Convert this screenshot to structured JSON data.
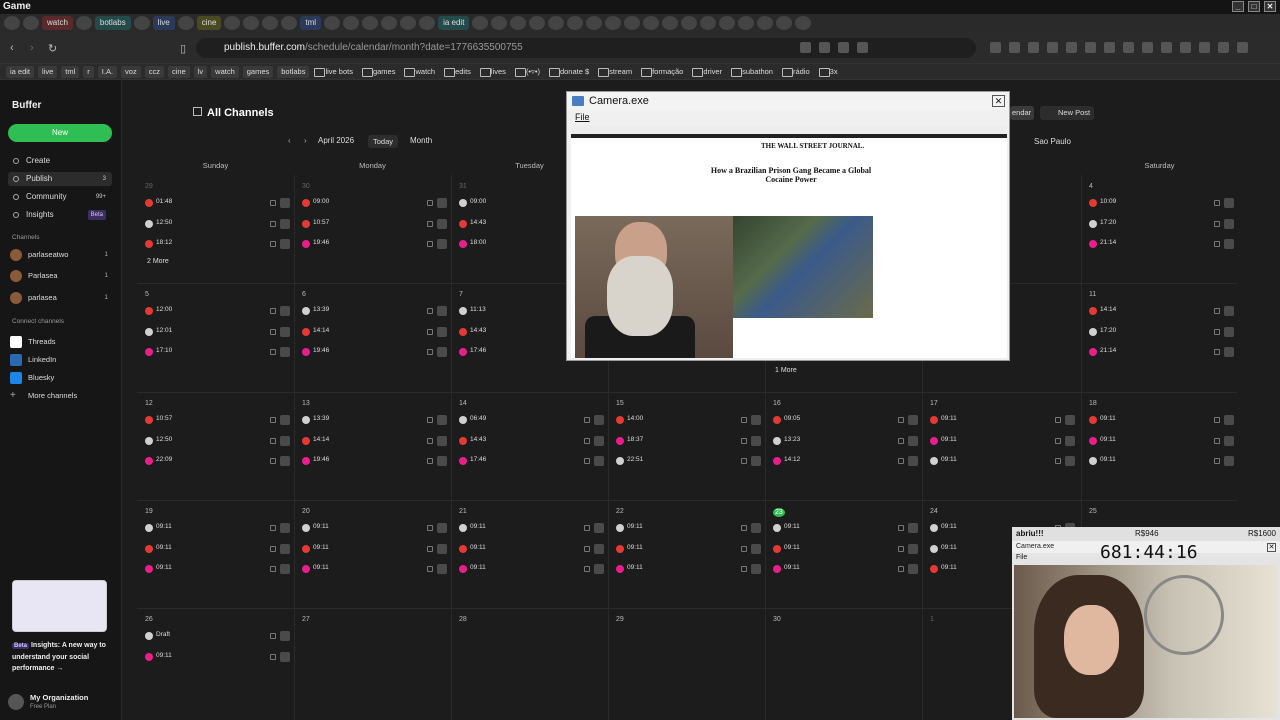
{
  "window": {
    "title": "Game"
  },
  "tabs": [
    "watch",
    "botlabs",
    "live",
    "cine",
    "tml",
    "ia edit"
  ],
  "url": {
    "host": "publish.buffer.com",
    "path": "/schedule/calendar/month?date=1776635500755"
  },
  "bookmarks": [
    "ia edit",
    "live",
    "tml",
    "r",
    "I.A.",
    "voz",
    "ccz",
    "cine",
    "lv",
    "watch",
    "games",
    "botlabs",
    "live bots",
    "games",
    "watch",
    "edits",
    "lives",
    "(•▿•)",
    "donate $",
    "stream",
    "formação",
    "driver",
    "subathon",
    "rádio",
    "3x"
  ],
  "sidebar": {
    "logo": "Buffer",
    "new_label": "New",
    "nav": [
      {
        "label": "Create"
      },
      {
        "label": "Publish",
        "count": "3"
      },
      {
        "label": "Community",
        "count": "99+"
      },
      {
        "label": "Insights",
        "badge": "Beta"
      }
    ],
    "channels_header": "Channels",
    "channels": [
      {
        "name": "parlaseatwo",
        "count": "1"
      },
      {
        "name": "Parlasea",
        "count": "1"
      },
      {
        "name": "parlasea",
        "count": "1"
      }
    ],
    "connect_header": "Connect channels",
    "connect": [
      "Threads",
      "LinkedIn",
      "Bluesky",
      "More channels"
    ],
    "promo": {
      "badge": "Beta",
      "text": "Insights: A new way to understand your social performance →"
    },
    "org": {
      "name": "My Organization",
      "plan": "Free Plan"
    }
  },
  "header": {
    "title": "All Channels",
    "month": "April 2026",
    "today": "Today",
    "view": "Month",
    "calendar_label": "endar",
    "new_post": "New Post",
    "timezone": "Sao Paulo"
  },
  "days": [
    "Sunday",
    "Monday",
    "Tuesday",
    "Saturday"
  ],
  "weeks": [
    {
      "nums": [
        "29",
        "30",
        "31",
        "",
        "",
        "",
        "4"
      ],
      "events": [
        {
          "d": 0,
          "t": "01:48",
          "k": "yt"
        },
        {
          "d": 0,
          "t": "12:50",
          "k": "gr"
        },
        {
          "d": 0,
          "t": "18:12",
          "k": "yt"
        },
        {
          "d": 1,
          "t": "09:00",
          "k": "yt"
        },
        {
          "d": 1,
          "t": "10:57",
          "k": "yt"
        },
        {
          "d": 1,
          "t": "19:46",
          "k": "tt"
        },
        {
          "d": 2,
          "t": "09:00",
          "k": "gr"
        },
        {
          "d": 2,
          "t": "14:43",
          "k": "yt"
        },
        {
          "d": 2,
          "t": "18:00",
          "k": "tt"
        },
        {
          "d": 6,
          "t": "10:09",
          "k": "yt"
        },
        {
          "d": 6,
          "t": "17:20",
          "k": "gr"
        },
        {
          "d": 6,
          "t": "21:14",
          "k": "tt"
        }
      ],
      "more": "2 More"
    },
    {
      "nums": [
        "5",
        "6",
        "7",
        "",
        "",
        "",
        "11"
      ],
      "events": [
        {
          "d": 0,
          "t": "12:00",
          "k": "yt"
        },
        {
          "d": 0,
          "t": "12:01",
          "k": "gr"
        },
        {
          "d": 0,
          "t": "17:10",
          "k": "tt"
        },
        {
          "d": 1,
          "t": "13:39",
          "k": "gr"
        },
        {
          "d": 1,
          "t": "14:14",
          "k": "yt"
        },
        {
          "d": 1,
          "t": "19:46",
          "k": "tt"
        },
        {
          "d": 2,
          "t": "11:13",
          "k": "gr"
        },
        {
          "d": 2,
          "t": "14:43",
          "k": "yt"
        },
        {
          "d": 2,
          "t": "17:46",
          "k": "tt"
        },
        {
          "d": 6,
          "t": "14:14",
          "k": "yt"
        },
        {
          "d": 6,
          "t": "17:20",
          "k": "gr"
        },
        {
          "d": 6,
          "t": "21:14",
          "k": "tt"
        }
      ],
      "more": "1 More"
    },
    {
      "nums": [
        "12",
        "13",
        "14",
        "15",
        "16",
        "17",
        "18"
      ],
      "events": [
        {
          "d": 0,
          "t": "10:57",
          "k": "yt"
        },
        {
          "d": 0,
          "t": "12:50",
          "k": "gr"
        },
        {
          "d": 0,
          "t": "22:09",
          "k": "tt"
        },
        {
          "d": 1,
          "t": "13:39",
          "k": "gr"
        },
        {
          "d": 1,
          "t": "14:14",
          "k": "yt"
        },
        {
          "d": 1,
          "t": "19:46",
          "k": "tt"
        },
        {
          "d": 2,
          "t": "06:49",
          "k": "gr"
        },
        {
          "d": 2,
          "t": "14:43",
          "k": "yt"
        },
        {
          "d": 2,
          "t": "17:46",
          "k": "tt"
        },
        {
          "d": 3,
          "t": "14:00",
          "k": "yt"
        },
        {
          "d": 3,
          "t": "18:37",
          "k": "tt"
        },
        {
          "d": 3,
          "t": "22:51",
          "k": "gr"
        },
        {
          "d": 4,
          "t": "09:05",
          "k": "yt"
        },
        {
          "d": 4,
          "t": "13:23",
          "k": "gr"
        },
        {
          "d": 4,
          "t": "14:12",
          "k": "tt"
        },
        {
          "d": 5,
          "t": "09:11",
          "k": "yt"
        },
        {
          "d": 5,
          "t": "09:11",
          "k": "tt"
        },
        {
          "d": 5,
          "t": "09:11",
          "k": "gr"
        },
        {
          "d": 6,
          "t": "09:11",
          "k": "yt"
        },
        {
          "d": 6,
          "t": "09:11",
          "k": "tt"
        },
        {
          "d": 6,
          "t": "09:11",
          "k": "gr"
        }
      ]
    },
    {
      "nums": [
        "19",
        "20",
        "21",
        "22",
        "23",
        "24",
        "25"
      ],
      "events": [
        {
          "d": 0,
          "t": "09:11",
          "k": "gr"
        },
        {
          "d": 0,
          "t": "09:11",
          "k": "yt"
        },
        {
          "d": 0,
          "t": "09:11",
          "k": "tt"
        },
        {
          "d": 1,
          "t": "09:11",
          "k": "gr"
        },
        {
          "d": 1,
          "t": "09:11",
          "k": "yt"
        },
        {
          "d": 1,
          "t": "09:11",
          "k": "tt"
        },
        {
          "d": 2,
          "t": "09:11",
          "k": "gr"
        },
        {
          "d": 2,
          "t": "09:11",
          "k": "yt"
        },
        {
          "d": 2,
          "t": "09:11",
          "k": "tt"
        },
        {
          "d": 3,
          "t": "09:11",
          "k": "gr"
        },
        {
          "d": 3,
          "t": "09:11",
          "k": "yt"
        },
        {
          "d": 3,
          "t": "09:11",
          "k": "tt"
        },
        {
          "d": 4,
          "t": "09:11",
          "k": "gr"
        },
        {
          "d": 4,
          "t": "09:11",
          "k": "yt"
        },
        {
          "d": 4,
          "t": "09:11",
          "k": "tt"
        },
        {
          "d": 5,
          "t": "09:11",
          "k": "gr"
        },
        {
          "d": 5,
          "t": "09:11",
          "k": "gr"
        },
        {
          "d": 5,
          "t": "09:11",
          "k": "yt"
        }
      ]
    },
    {
      "nums": [
        "26",
        "27",
        "28",
        "29",
        "30",
        "1",
        ""
      ],
      "events": [
        {
          "d": 0,
          "t": "Draft",
          "k": "gr"
        },
        {
          "d": 0,
          "t": "09:11",
          "k": "tt"
        }
      ]
    }
  ],
  "camera": {
    "title": "Camera.exe",
    "menu": "File",
    "site": "THE WALL STREET JOURNAL.",
    "headline": "How a Brazilian Prison Gang Became a Global Cocaine Power"
  },
  "camera2": {
    "goal": "abriu!!!",
    "m1": "R$946",
    "m2": "R$1600",
    "title": "Camera.exe",
    "timer": "681:44:16",
    "menu": "File"
  }
}
